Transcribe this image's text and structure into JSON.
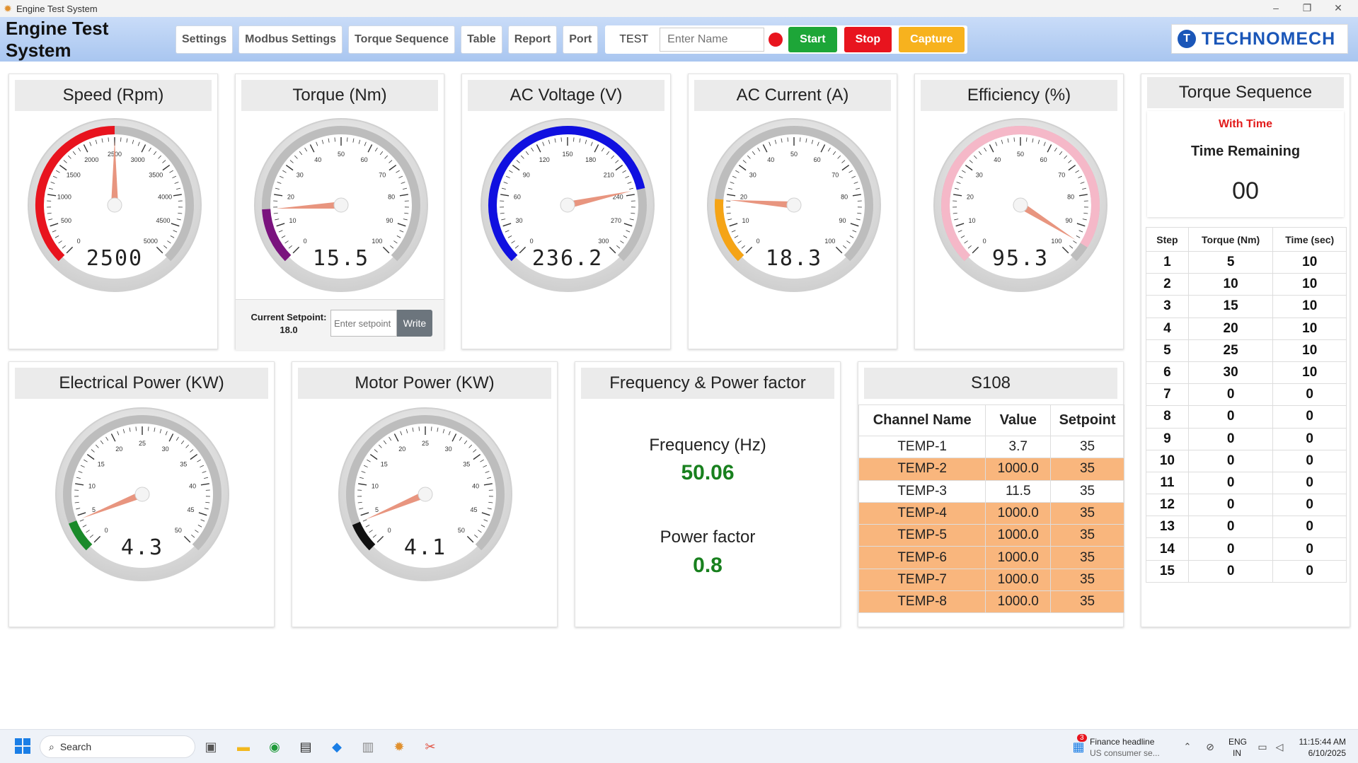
{
  "window": {
    "title": "Engine Test System",
    "minimize": "–",
    "maximize": "❐",
    "close": "✕"
  },
  "header": {
    "title": "Engine Test System",
    "nav": [
      "Settings",
      "Modbus Settings",
      "Torque Sequence",
      "Table",
      "Report",
      "Port"
    ],
    "test_label": "TEST",
    "name_placeholder": "Enter Name",
    "start": "Start",
    "stop": "Stop",
    "capture": "Capture",
    "logo_text": "TECHNOMECH",
    "logo_mark": "T",
    "colors": {
      "start": "#1da638",
      "stop": "#e8141e",
      "capture": "#f7b21e",
      "brand": "#1a56b8"
    }
  },
  "gauges": [
    {
      "title": "Speed (Rpm)",
      "value": 2500,
      "display": "2500",
      "min": 0,
      "max": 5000,
      "ticks": [
        "0",
        "500",
        "1000",
        "1500",
        "2000",
        "2500",
        "3000",
        "3500",
        "4000",
        "4500",
        "5000"
      ],
      "arc_color": "#e8141e",
      "arc_to": 2500
    },
    {
      "title": "Torque (Nm)",
      "value": 15.5,
      "display": "15.5",
      "min": 0,
      "max": 100,
      "ticks": [
        "0",
        "10",
        "20",
        "30",
        "40",
        "50",
        "60",
        "70",
        "80",
        "90",
        "100"
      ],
      "arc_color": "#7a137e",
      "arc_to": 15.5
    },
    {
      "title": "AC Voltage (V)",
      "value": 236.2,
      "display": "236.2",
      "min": 0,
      "max": 300,
      "ticks": [
        "0",
        "30",
        "60",
        "90",
        "120",
        "150",
        "180",
        "210",
        "240",
        "270",
        "300"
      ],
      "arc_color": "#1010e0",
      "arc_to": 236.2
    },
    {
      "title": "AC Current (A)",
      "value": 18.3,
      "display": "18.3",
      "min": 0,
      "max": 100,
      "ticks": [
        "0",
        "10",
        "20",
        "30",
        "40",
        "50",
        "60",
        "70",
        "80",
        "90",
        "100"
      ],
      "arc_color": "#f5a416",
      "arc_to": 18.3
    },
    {
      "title": "Efficiency (%)",
      "value": 95.3,
      "display": "95.3",
      "min": 0,
      "max": 100,
      "ticks": [
        "0",
        "10",
        "20",
        "30",
        "40",
        "50",
        "60",
        "70",
        "80",
        "90",
        "100"
      ],
      "arc_color": "#f5b8c8",
      "arc_to": 95.3
    },
    {
      "title": "Electrical Power (KW)",
      "value": 4.3,
      "display": "4.3",
      "min": 0,
      "max": 50,
      "ticks": [
        "0",
        "5",
        "10",
        "15",
        "20",
        "25",
        "30",
        "35",
        "40",
        "45",
        "50"
      ],
      "arc_color": "#1a8a2a",
      "arc_to": 4.3
    },
    {
      "title": "Motor Power (KW)",
      "value": 4.1,
      "display": "4.1",
      "min": 0,
      "max": 50,
      "ticks": [
        "0",
        "5",
        "10",
        "15",
        "20",
        "25",
        "30",
        "35",
        "40",
        "45",
        "50"
      ],
      "arc_color": "#111111",
      "arc_to": 4.1
    }
  ],
  "setpoint": {
    "label": "Current Setpoint:",
    "value": "18.0",
    "placeholder": "Enter setpoint",
    "write": "Write"
  },
  "freq_panel": {
    "title": "Frequency & Power factor",
    "freq_label": "Frequency (Hz)",
    "freq_value": "50.06",
    "pf_label": "Power factor",
    "pf_value": "0.8"
  },
  "s108": {
    "title": "S108",
    "headers": [
      "Channel Name",
      "Value",
      "Setpoint"
    ],
    "rows": [
      {
        "name": "TEMP-1",
        "value": "3.7",
        "setpoint": "35",
        "alarm": false
      },
      {
        "name": "TEMP-2",
        "value": "1000.0",
        "setpoint": "35",
        "alarm": true
      },
      {
        "name": "TEMP-3",
        "value": "11.5",
        "setpoint": "35",
        "alarm": false
      },
      {
        "name": "TEMP-4",
        "value": "1000.0",
        "setpoint": "35",
        "alarm": true
      },
      {
        "name": "TEMP-5",
        "value": "1000.0",
        "setpoint": "35",
        "alarm": true
      },
      {
        "name": "TEMP-6",
        "value": "1000.0",
        "setpoint": "35",
        "alarm": true
      },
      {
        "name": "TEMP-7",
        "value": "1000.0",
        "setpoint": "35",
        "alarm": true
      },
      {
        "name": "TEMP-8",
        "value": "1000.0",
        "setpoint": "35",
        "alarm": true
      }
    ],
    "alarm_color": "#f9b67d"
  },
  "torque_sequence": {
    "title": "Torque Sequence",
    "mode": "With Time",
    "remaining_label": "Time Remaining",
    "remaining_value": "00",
    "headers": [
      "Step",
      "Torque (Nm)",
      "Time (sec)"
    ],
    "rows": [
      [
        "1",
        "5",
        "10"
      ],
      [
        "2",
        "10",
        "10"
      ],
      [
        "3",
        "15",
        "10"
      ],
      [
        "4",
        "20",
        "10"
      ],
      [
        "5",
        "25",
        "10"
      ],
      [
        "6",
        "30",
        "10"
      ],
      [
        "7",
        "0",
        "0"
      ],
      [
        "8",
        "0",
        "0"
      ],
      [
        "9",
        "0",
        "0"
      ],
      [
        "10",
        "0",
        "0"
      ],
      [
        "11",
        "0",
        "0"
      ],
      [
        "12",
        "0",
        "0"
      ],
      [
        "13",
        "0",
        "0"
      ],
      [
        "14",
        "0",
        "0"
      ],
      [
        "15",
        "0",
        "0"
      ]
    ]
  },
  "taskbar": {
    "search": "Search",
    "news_title": "Finance headline",
    "news_sub": "US consumer se...",
    "news_badge": "3",
    "lang1": "ENG",
    "lang2": "IN",
    "time": "11:15:44 AM",
    "date": "6/10/2025"
  }
}
